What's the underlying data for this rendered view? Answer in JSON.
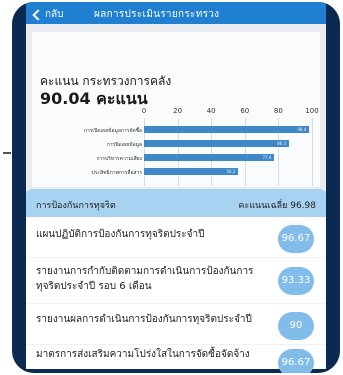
{
  "topbar": {
    "back_label": "กลับ",
    "title": "ผลการประเมินรายกระทรวง"
  },
  "score": {
    "label": "คะแนน กระทรวงการคลัง",
    "value": "90.04 คะแนน"
  },
  "chart_data": {
    "type": "bar",
    "x_ticks": [
      "0",
      "20",
      "40",
      "60",
      "80",
      "100"
    ],
    "xlim": [
      0,
      100
    ],
    "categories": [
      "การเปิดเผยข้อมูลการจัดซื้อ",
      "การปิดเผยข้อมูล",
      "การบริหารความเสี่ยง",
      "ประสิทธิภาพการสื่อสาร"
    ],
    "values": [
      98.4,
      86.3,
      77.6,
      56.2
    ]
  },
  "sheet": {
    "title": "การป้องกันการทุจริต",
    "average": "คะแนนเฉลี่ย 96.98",
    "items": [
      {
        "text": "แผนปฏิบัติการป้องกันการทุจริตประจำปี",
        "score": "96.67"
      },
      {
        "text": "รายงานการกำกับติดตามการดำเนินการป้องกันการทุจริตประจำปี รอบ 6 เดือน",
        "score": "93.33"
      },
      {
        "text": "รายงานผลการดำเนินการป้องกันการทุจริตประจำปี",
        "score": "90"
      },
      {
        "text": "มาตรการส่งเสริมความโปร่งใสในการจัดซื้อจัดจ้าง",
        "score": "96.67"
      }
    ]
  }
}
